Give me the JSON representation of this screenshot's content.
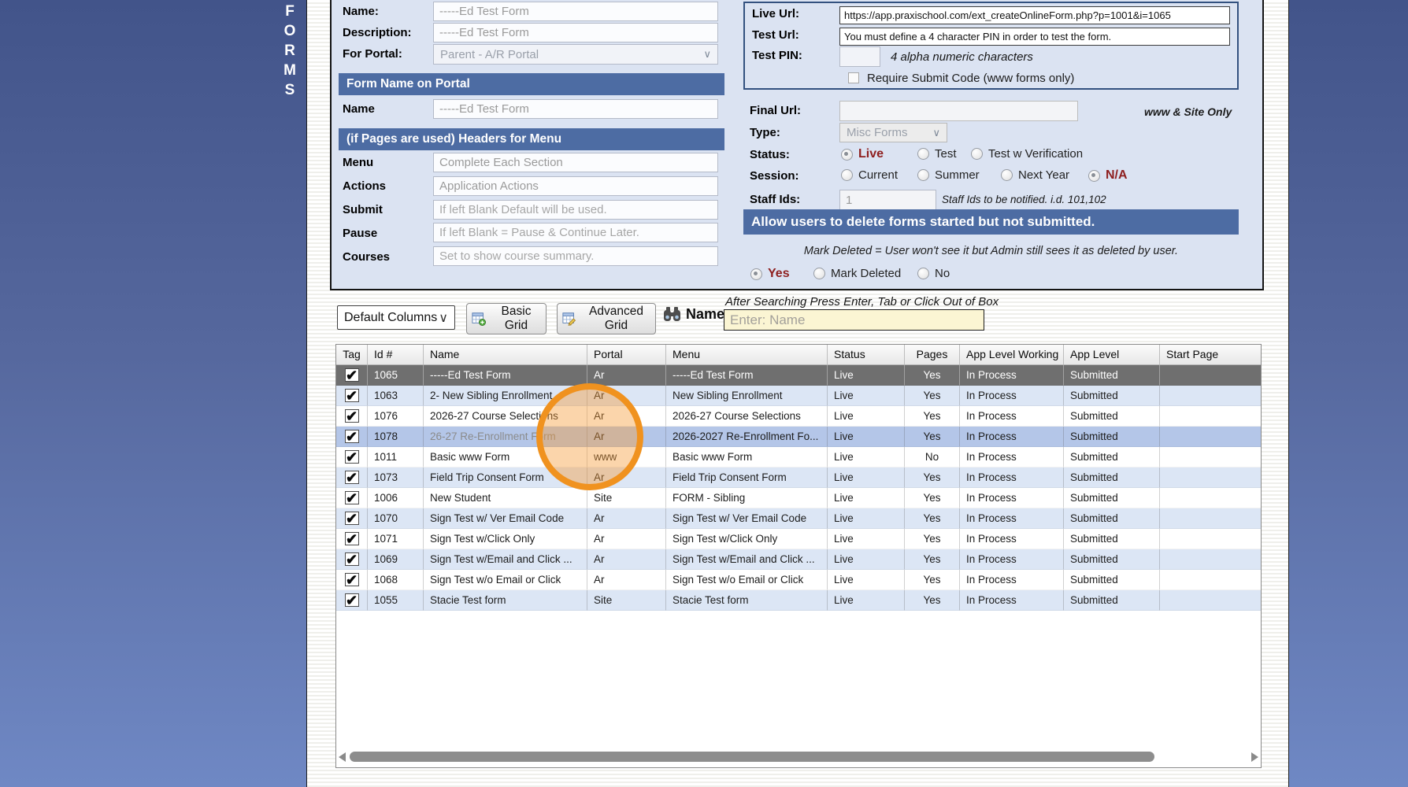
{
  "sidebar": {
    "tab_label": "FORMS",
    "letters": [
      "F",
      "O",
      "R",
      "M",
      "S"
    ]
  },
  "icons": {
    "chevron": "∨"
  },
  "left_form": {
    "name_label": "Name:",
    "name_value": "-----Ed Test Form",
    "description_label": "Description:",
    "description_value": "-----Ed Test Form",
    "for_portal_label": "For Portal:",
    "for_portal_value": "Parent - A/R Portal",
    "section_portal_title": "Form Name on Portal",
    "portal_name_label": "Name",
    "portal_name_value": "-----Ed Test Form",
    "section_menu_title": "(if Pages are used) Headers for Menu",
    "menu_label": "Menu",
    "menu_value": "Complete Each Section",
    "actions_label": "Actions",
    "actions_value": "Application Actions",
    "submit_label": "Submit",
    "submit_placeholder": "If left Blank Default will be used.",
    "pause_label": "Pause",
    "pause_placeholder": "If left Blank = Pause & Continue Later.",
    "courses_label": "Courses",
    "courses_placeholder": "Set to show course summary."
  },
  "right_form": {
    "live_url_label": "Live Url:",
    "live_url_value": "https://app.praxischool.com/ext_createOnlineForm.php?p=1001&i=1065",
    "test_url_label": "Test Url:",
    "test_url_value": "You must define a 4 character PIN in order to test the form.",
    "test_pin_label": "Test PIN:",
    "test_pin_hint": "4 alpha numeric characters",
    "require_submit_label": "Require Submit Code (www forms only)",
    "final_url_label": "Final Url:",
    "final_url_hint": "www & Site Only",
    "type_label": "Type:",
    "type_value": "Misc Forms",
    "status_label": "Status:",
    "status_options": [
      "Live",
      "Test",
      "Test w Verification"
    ],
    "status_selected": "Live",
    "session_label": "Session:",
    "session_options": [
      "Current",
      "Summer",
      "Next Year",
      "N/A"
    ],
    "session_selected": "N/A",
    "staff_ids_label": "Staff Ids:",
    "staff_ids_value": "1",
    "staff_ids_hint": "Staff Ids to be notified. i.d. 101,102",
    "delete_bar_title": "Allow users to delete forms started but not submitted.",
    "mark_deleted_note": "Mark Deleted = User won't see it but Admin still sees it as deleted by user.",
    "delete_options": [
      "Yes",
      "Mark Deleted",
      "No"
    ],
    "delete_selected": "Yes"
  },
  "toolbar": {
    "columns_select_value": "Default Columns",
    "basic_grid_label": "Basic Grid",
    "advanced_grid_label": "Advanced Grid",
    "search_field_label": "Name",
    "search_hint": "After Searching Press Enter, Tab or Click Out of Box",
    "search_placeholder": "Enter: Name"
  },
  "table": {
    "check_glyph": "✔",
    "columns": [
      "Tag",
      "Id #",
      "Name",
      "Portal",
      "Menu",
      "Status",
      "Pages",
      "App Level Working",
      "App Level",
      "Start Page"
    ],
    "rows": [
      {
        "id": "1065",
        "name": "-----Ed Test Form",
        "portal": "Ar",
        "menu": "-----Ed Test Form",
        "status": "Live",
        "pages": "Yes",
        "app_level_working": "In Process",
        "app_level": "Submitted",
        "start_page": "",
        "selected": true
      },
      {
        "id": "1063",
        "name": "2- New Sibling Enrollment",
        "portal": "Ar",
        "menu": "New Sibling Enrollment",
        "status": "Live",
        "pages": "Yes",
        "app_level_working": "In Process",
        "app_level": "Submitted",
        "start_page": ""
      },
      {
        "id": "1076",
        "name": "2026-27 Course Selections",
        "portal": "Ar",
        "menu": "2026-27 Course Selections",
        "status": "Live",
        "pages": "Yes",
        "app_level_working": "In Process",
        "app_level": "Submitted",
        "start_page": ""
      },
      {
        "id": "1078",
        "name": "26-27 Re-Enrollment Form",
        "portal": "Ar",
        "menu": "2026-2027 Re-Enrollment Fo...",
        "status": "Live",
        "pages": "Yes",
        "app_level_working": "In Process",
        "app_level": "Submitted",
        "start_page": "",
        "highlight": true,
        "name_muted": true
      },
      {
        "id": "1011",
        "name": "Basic www Form",
        "portal": "www",
        "menu": "Basic www Form",
        "status": "Live",
        "pages": "No",
        "app_level_working": "In Process",
        "app_level": "Submitted",
        "start_page": ""
      },
      {
        "id": "1073",
        "name": "Field Trip Consent Form",
        "portal": "Ar",
        "menu": "Field Trip Consent Form",
        "status": "Live",
        "pages": "Yes",
        "app_level_working": "In Process",
        "app_level": "Submitted",
        "start_page": ""
      },
      {
        "id": "1006",
        "name": "New Student",
        "portal": "Site",
        "menu": "FORM - Sibling",
        "status": "Live",
        "pages": "Yes",
        "app_level_working": "In Process",
        "app_level": "Submitted",
        "start_page": ""
      },
      {
        "id": "1070",
        "name": "Sign Test w/ Ver Email Code",
        "portal": "Ar",
        "menu": "Sign Test w/ Ver Email Code",
        "status": "Live",
        "pages": "Yes",
        "app_level_working": "In Process",
        "app_level": "Submitted",
        "start_page": ""
      },
      {
        "id": "1071",
        "name": "Sign Test w/Click Only",
        "portal": "Ar",
        "menu": "Sign Test w/Click Only",
        "status": "Live",
        "pages": "Yes",
        "app_level_working": "In Process",
        "app_level": "Submitted",
        "start_page": ""
      },
      {
        "id": "1069",
        "name": "Sign Test w/Email and Click ...",
        "portal": "Ar",
        "menu": "Sign Test w/Email and Click ...",
        "status": "Live",
        "pages": "Yes",
        "app_level_working": "In Process",
        "app_level": "Submitted",
        "start_page": ""
      },
      {
        "id": "1068",
        "name": "Sign Test w/o Email or Click",
        "portal": "Ar",
        "menu": "Sign Test w/o Email or Click",
        "status": "Live",
        "pages": "Yes",
        "app_level_working": "In Process",
        "app_level": "Submitted",
        "start_page": ""
      },
      {
        "id": "1055",
        "name": "Stacie Test form",
        "portal": "Site",
        "menu": "Stacie Test form",
        "status": "Live",
        "pages": "Yes",
        "app_level_working": "In Process",
        "app_level": "Submitted",
        "start_page": ""
      }
    ]
  },
  "annotation": {
    "type": "click-highlight-circle",
    "color": "#f0921f"
  },
  "colors": {
    "section_bar": "#4d6ca3",
    "panel_bg": "#dbe3f2",
    "selected_row": "#6f6f6f",
    "highlight_row": "#b4c6e8",
    "alt_row": "#dce6f5",
    "search_bg": "#fbf5d3",
    "accent_text": "#8e1f1f"
  }
}
